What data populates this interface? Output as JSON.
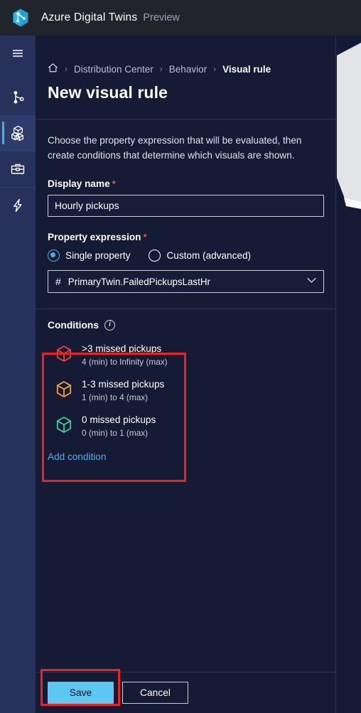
{
  "topbar": {
    "logo_icon": "azure-digital-twins-logo",
    "title": "Azure Digital Twins",
    "preview_label": "Preview"
  },
  "rail": {
    "items": [
      {
        "icon": "hamburger-menu-icon",
        "name": "menu",
        "selected": false
      },
      {
        "icon": "twin-graph-icon",
        "name": "twin-graph",
        "selected": false
      },
      {
        "icon": "models-cubes-icon",
        "name": "models",
        "selected": true
      },
      {
        "icon": "toolbox-icon",
        "name": "build",
        "selected": false
      },
      {
        "icon": "lightning-bolt-icon",
        "name": "behaviors",
        "selected": false
      }
    ]
  },
  "breadcrumb": {
    "home_icon": "home-icon",
    "separator": "›",
    "items": [
      {
        "label": "Distribution Center",
        "current": false
      },
      {
        "label": "Behavior",
        "current": false
      },
      {
        "label": "Visual rule",
        "current": true
      }
    ]
  },
  "page": {
    "title": "New visual rule",
    "description": "Choose the property expression that will be evaluated, then create conditions that determine which visuals are shown."
  },
  "display_name": {
    "label": "Display name",
    "required_mark": "*",
    "value": "Hourly pickups",
    "placeholder": "Display name"
  },
  "property_expression": {
    "label": "Property expression",
    "required_mark": "*",
    "options": [
      {
        "label": "Single property",
        "selected": true
      },
      {
        "label": "Custom (advanced)",
        "selected": false
      }
    ],
    "select": {
      "prefix_icon": "hash-icon",
      "value": "PrimaryTwin.FailedPickupsLastHr",
      "chevron_icon": "chevron-down-icon"
    }
  },
  "conditions": {
    "label": "Conditions",
    "info_icon": "info-icon",
    "items": [
      {
        "icon": "cube-icon",
        "color": "#E8423A",
        "title": ">3 missed pickups",
        "range": "4 (min) to Infinity (max)"
      },
      {
        "icon": "cube-icon",
        "color": "#F2A33C",
        "title": "1-3 missed pickups",
        "range": "1 (min) to 4 (max)"
      },
      {
        "icon": "cube-icon",
        "color": "#3CCFA0",
        "title": "0 missed pickups",
        "range": "0 (min) to 1 (max)"
      }
    ],
    "add_link": "Add condition"
  },
  "footer": {
    "save_label": "Save",
    "cancel_label": "Cancel"
  },
  "annotations": {
    "highlight_color": "#F02020"
  }
}
